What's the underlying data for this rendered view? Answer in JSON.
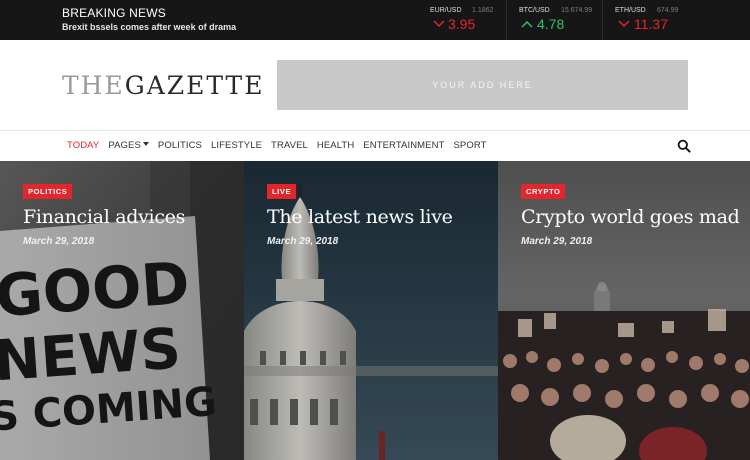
{
  "topbar": {
    "breaking_title": "BREAKING NEWS",
    "breaking_text": "Brexit bssels comes after week of drama",
    "tickers": [
      {
        "pair": "EUR/USD",
        "rate": "1.1862",
        "change": "3.95",
        "direction": "down"
      },
      {
        "pair": "BTC/USD",
        "rate": "15.674.99",
        "change": "4.78",
        "direction": "up"
      },
      {
        "pair": "ETH/USD",
        "rate": "674.99",
        "change": "11.37",
        "direction": "down"
      }
    ]
  },
  "header": {
    "logo_the": "THE",
    "logo_gazette": "GAZETTE",
    "ad_text": "YOUR ADD HERE"
  },
  "nav": {
    "items": [
      "TODAY",
      "PAGES",
      "POLITICS",
      "LIFESTYLE",
      "TRAVEL",
      "HEALTH",
      "ENTERTAINMENT",
      "SPORT"
    ],
    "active_index": 0,
    "search_icon": "search-icon"
  },
  "cards": [
    {
      "badge": "POLITICS",
      "title": "Financial advices",
      "date": "March 29, 2018",
      "image": "protest sign 'GOOD NEWS IS COMING'",
      "sign_lines": [
        "GOOD",
        "NEWS",
        "S COMING"
      ]
    },
    {
      "badge": "LIVE",
      "title": "The latest news live",
      "date": "March 29, 2018",
      "image": "capitol dome"
    },
    {
      "badge": "CRYPTO",
      "title": "Crypto world goes mad",
      "date": "March 29, 2018",
      "image": "crowd of protesters"
    }
  ],
  "colors": {
    "accent": "#e3262c",
    "topbar_bg": "#161616",
    "up": "#2ec06a",
    "down": "#e3262c",
    "ad_bg": "#c8c8c8"
  }
}
